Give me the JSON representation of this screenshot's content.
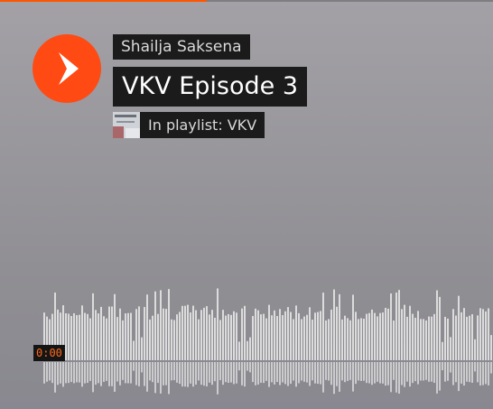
{
  "player": {
    "artist": "Shailja Saksena",
    "title": "VKV Episode 3",
    "playlist_label": "In playlist: VKV",
    "current_time": "0:00",
    "progress_fraction": 0.42,
    "colors": {
      "accent": "#ff5500",
      "label_bg": "#1b1b1b",
      "waveform": "#dcdcdc"
    },
    "icons": {
      "play": "play-icon",
      "thumbnail": "playlist-artwork"
    }
  }
}
